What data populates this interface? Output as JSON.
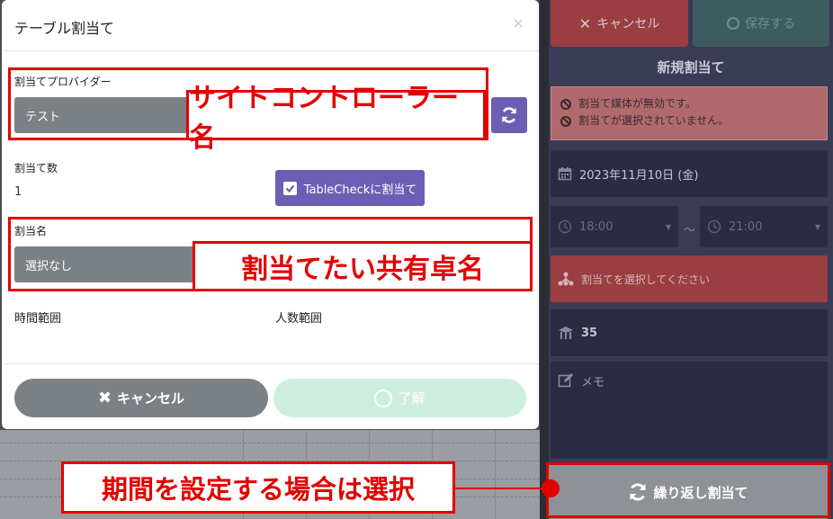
{
  "modal": {
    "title": "テーブル割当て",
    "close_glyph": "×",
    "provider_label": "割当てプロバイダー",
    "provider_value": "テスト",
    "count_label": "割当て数",
    "count_value": "1",
    "tablecheck_label": "TableCheckに割当て",
    "name_label": "割当名",
    "name_value": "選択なし",
    "time_range_label": "時間範囲",
    "people_range_label": "人数範囲",
    "cancel_label": "キャンセル",
    "ok_label": "了解"
  },
  "right_panel": {
    "cancel_label": "キャンセル",
    "save_label": "保存する",
    "title": "新規割当て",
    "alerts": [
      "割当て媒体が無効です。",
      "割当てが選択されていません。"
    ],
    "date": "2023年11月10日 (金)",
    "time_start": "18:00",
    "time_sep": "～",
    "time_end": "21:00",
    "assign_placeholder": "割当てを選択してください",
    "count": "35",
    "memo_placeholder": "メモ",
    "repeat_label": "繰り返し割当て"
  },
  "annotations": {
    "site_controller": "サイトコントローラー名",
    "shared_table": "割当てたい共有卓名",
    "period": "期間を設定する場合は選択"
  },
  "colors": {
    "annotation_red": "#e30000",
    "primary_purple": "#6b5fb5",
    "danger": "#9a3e42",
    "panel_bg": "#3a3b55"
  }
}
